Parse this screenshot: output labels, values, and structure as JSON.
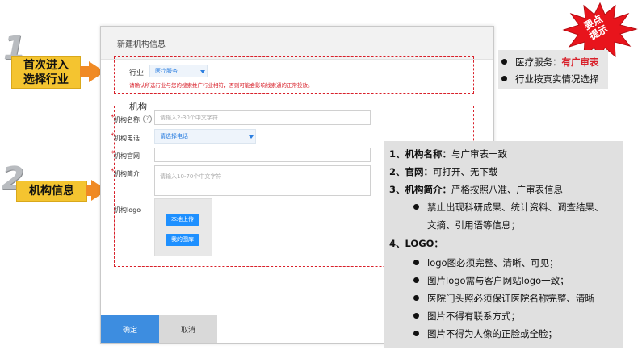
{
  "steps": [
    {
      "number": "1",
      "label": "首次进入\n选择行业"
    },
    {
      "number": "2",
      "label": "机构信息"
    }
  ],
  "badge": {
    "line1": "要点",
    "line2": "提示"
  },
  "dialog": {
    "title": "新建机构信息",
    "industry_label": "行业",
    "industry_value": "医疗服务",
    "industry_warning": "请确认所选行业与您的搜索推广行业相符，否则可能会影响线索通的正常投放。",
    "section_title": "机构",
    "fields": {
      "name_label": "机构名称",
      "name_placeholder": "请输入2-30个中文字符",
      "phone_label": "机构电话",
      "phone_value": "请选择电话",
      "website_label": "机构官网",
      "intro_label": "机构简介",
      "intro_placeholder": "请输入10-70个中文字符",
      "logo_label": "机构logo"
    },
    "upload_local": "本地上传",
    "my_images": "我的图库",
    "confirm": "确定",
    "cancel": "取消"
  },
  "note_top": {
    "line1_prefix": "医疗服务：",
    "line1_highlight": "有广审表",
    "line2": "行业按真实情况选择"
  },
  "note_main": {
    "item1_num": "1、",
    "item1_bold": "机构名称：",
    "item1_text": "与广审表一致",
    "item2_num": "2、",
    "item2_bold": "官网：",
    "item2_text": "可打开、无下载",
    "item3_num": "3、",
    "item3_bold": "机构简介：",
    "item3_text": "严格按照八准、广审表信息",
    "item3_sub1": "禁止出现科研成果、统计资料、调查结果、",
    "item3_sub2": "文摘、引用语等信息；",
    "item4_num": "4、",
    "item4_bold": "LOGO：",
    "logo_rules": [
      "logo图必须完整、清晰、可见；",
      "图片logo需与客户网站logo一致；",
      "医院门头照必须保证医院名称完整、清晰",
      "图片不得有联系方式；",
      "图片不得为人像的正脸或全脸；"
    ]
  },
  "colors": {
    "accent": "#f08a24",
    "label_bg": "#f4c430",
    "dash": "#d8202a",
    "primary": "#3d8de0",
    "burst": "#e8141c"
  }
}
